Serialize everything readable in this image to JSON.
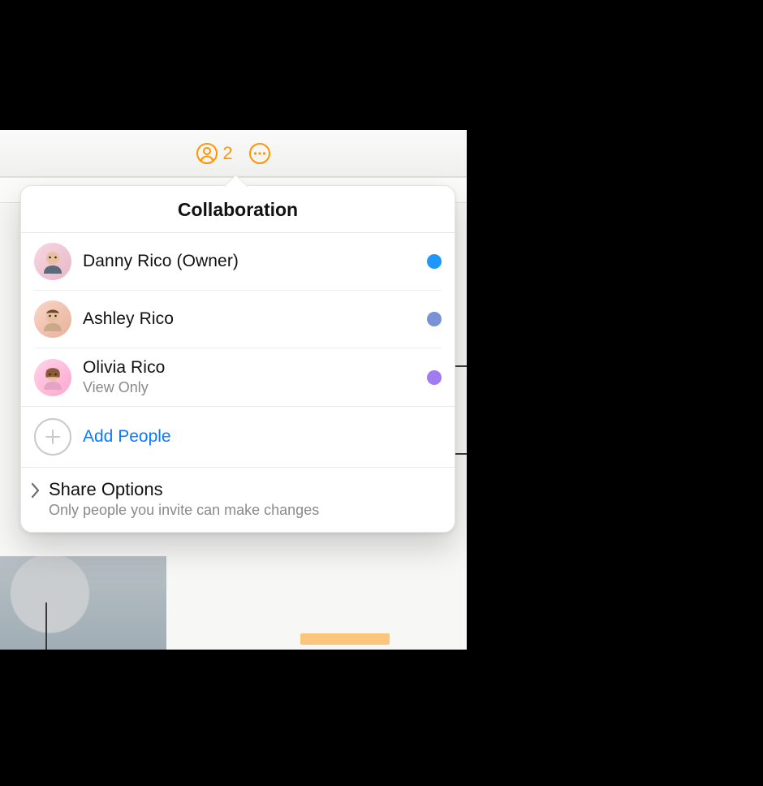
{
  "toolbar": {
    "collaborators_count": "2"
  },
  "popover": {
    "title": "Collaboration",
    "add_people_label": "Add People",
    "share_options_title": "Share Options",
    "share_options_subtitle": "Only people you invite can make changes"
  },
  "participants": [
    {
      "name": "Danny Rico (Owner)",
      "role": "",
      "dot_color": "#1e98ff"
    },
    {
      "name": "Ashley Rico",
      "role": "",
      "dot_color": "#7a93d6"
    },
    {
      "name": "Olivia Rico",
      "role": "View Only",
      "dot_color": "#a17bf2"
    }
  ]
}
